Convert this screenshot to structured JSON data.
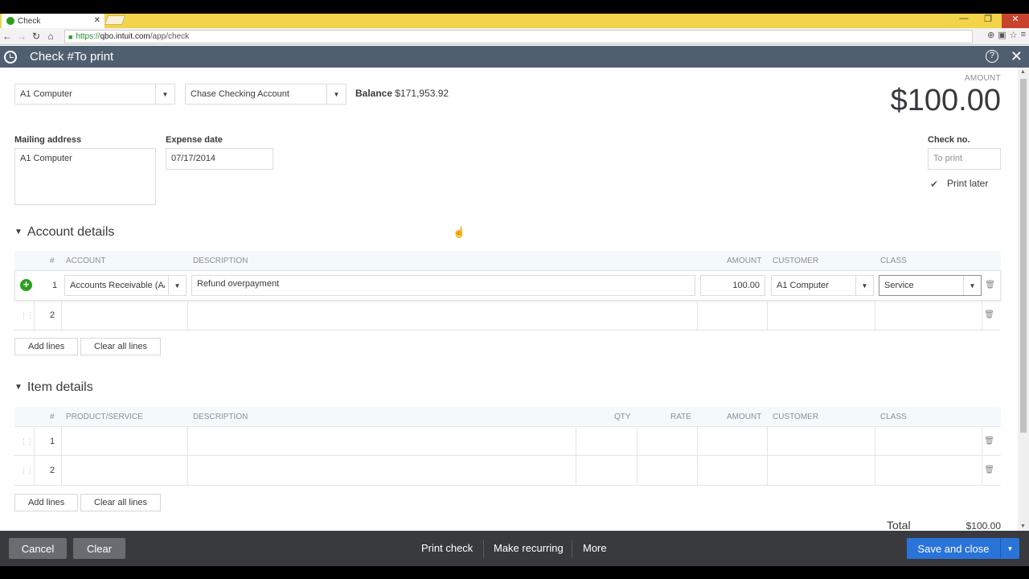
{
  "browser": {
    "tab_title": "Check",
    "url_scheme": "https://",
    "url_host": "qbo.intuit.com",
    "url_path": "/app/check"
  },
  "header": {
    "title": "Check #To print"
  },
  "form": {
    "payee": "A1 Computer",
    "bank_account": "Chase Checking Account",
    "balance_label": "Balance",
    "balance_value": "$171,953.92",
    "amount_label": "AMOUNT",
    "amount_value": "$100.00",
    "mailing_label": "Mailing address",
    "mailing_value": "A1 Computer",
    "expense_date_label": "Expense date",
    "expense_date_value": "07/17/2014",
    "check_no_label": "Check no.",
    "check_no_value": "To print",
    "print_later_label": "Print later",
    "print_later_checked": true
  },
  "account_details": {
    "title": "Account details",
    "columns": [
      "#",
      "ACCOUNT",
      "DESCRIPTION",
      "AMOUNT",
      "CUSTOMER",
      "CLASS"
    ],
    "rows": [
      {
        "num": "1",
        "account": "Accounts Receivable (A/",
        "description": "Refund overpayment",
        "amount": "100.00",
        "customer": "A1 Computer",
        "class": "Service"
      },
      {
        "num": "2",
        "account": "",
        "description": "",
        "amount": "",
        "customer": "",
        "class": ""
      }
    ],
    "add_lines": "Add lines",
    "clear_lines": "Clear all lines"
  },
  "item_details": {
    "title": "Item details",
    "columns": [
      "#",
      "PRODUCT/SERVICE",
      "DESCRIPTION",
      "QTY",
      "RATE",
      "AMOUNT",
      "CUSTOMER",
      "CLASS"
    ],
    "rows": [
      {
        "num": "1"
      },
      {
        "num": "2"
      }
    ],
    "add_lines": "Add lines",
    "clear_lines": "Clear all lines"
  },
  "totals": {
    "label": "Total",
    "value": "$100.00"
  },
  "footer": {
    "cancel": "Cancel",
    "clear": "Clear",
    "print_check": "Print check",
    "make_recurring": "Make recurring",
    "more": "More",
    "save_close": "Save and close"
  },
  "colors": {
    "titlebar": "#4f5f70",
    "footer": "#393a3d",
    "primary_button": "#2a73d9",
    "add_icon": "#2ca01c"
  }
}
